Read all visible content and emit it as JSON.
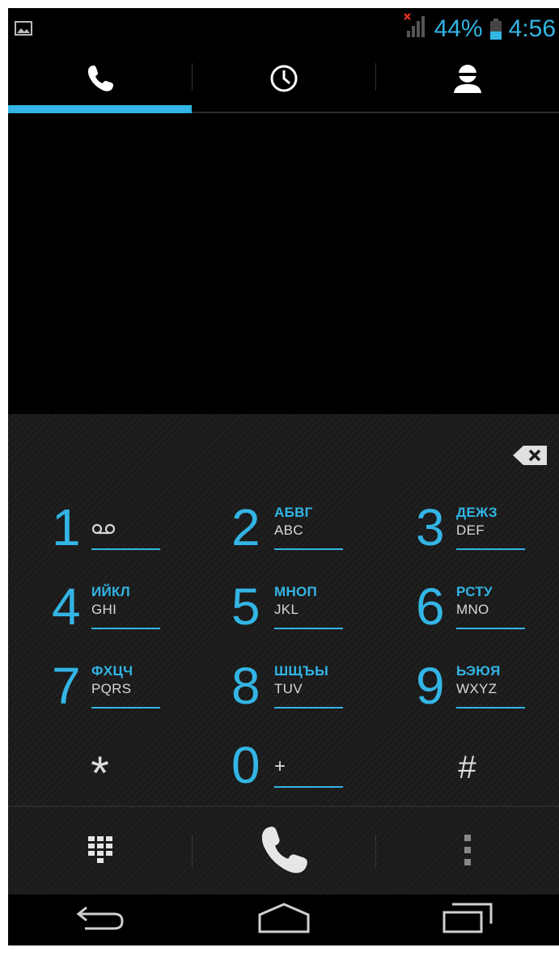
{
  "status_bar": {
    "notification_icon": "gallery-icon",
    "signal_icon": "no-signal-icon",
    "battery_percent": "44%",
    "battery_level": 0.44,
    "time": "4:56"
  },
  "tabs": [
    {
      "icon": "phone-icon",
      "active": true
    },
    {
      "icon": "clock-icon",
      "active": false
    },
    {
      "icon": "contact-icon",
      "active": false
    }
  ],
  "keypad": [
    {
      "digit": "1",
      "cyr": "",
      "lat": ""
    },
    {
      "digit": "2",
      "cyr": "АБВГ",
      "lat": "ABC"
    },
    {
      "digit": "3",
      "cyr": "ДЕЖЗ",
      "lat": "DEF"
    },
    {
      "digit": "4",
      "cyr": "ИЙКЛ",
      "lat": "GHI"
    },
    {
      "digit": "5",
      "cyr": "МНОП",
      "lat": "JKL"
    },
    {
      "digit": "6",
      "cyr": "РСТУ",
      "lat": "MNO"
    },
    {
      "digit": "7",
      "cyr": "ФХЦЧ",
      "lat": "PQRS"
    },
    {
      "digit": "8",
      "cyr": "ШЩЪЫ",
      "lat": "TUV"
    },
    {
      "digit": "9",
      "cyr": "ЬЭЮЯ",
      "lat": "WXYZ"
    },
    {
      "digit": "*"
    },
    {
      "digit": "0",
      "sub": "+"
    },
    {
      "digit": "#"
    }
  ],
  "colors": {
    "accent": "#33b5e5",
    "background": "#000000",
    "pad": "#1b1b1b"
  }
}
